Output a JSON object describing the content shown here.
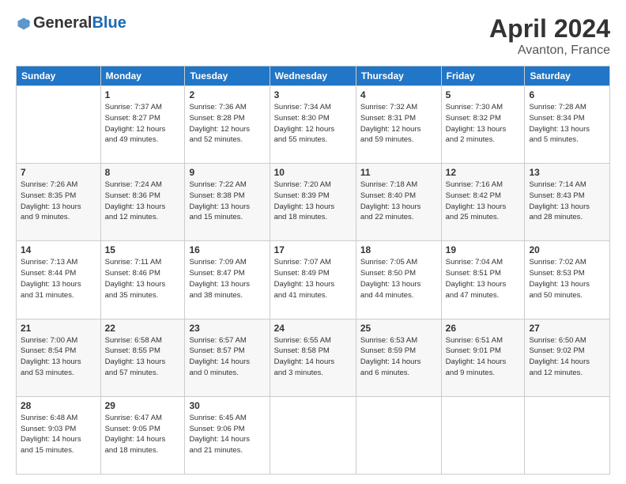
{
  "header": {
    "logo_general": "General",
    "logo_blue": "Blue",
    "month_title": "April 2024",
    "location": "Avanton, France"
  },
  "weekdays": [
    "Sunday",
    "Monday",
    "Tuesday",
    "Wednesday",
    "Thursday",
    "Friday",
    "Saturday"
  ],
  "weeks": [
    [
      {
        "day": "",
        "info": ""
      },
      {
        "day": "1",
        "info": "Sunrise: 7:37 AM\nSunset: 8:27 PM\nDaylight: 12 hours\nand 49 minutes."
      },
      {
        "day": "2",
        "info": "Sunrise: 7:36 AM\nSunset: 8:28 PM\nDaylight: 12 hours\nand 52 minutes."
      },
      {
        "day": "3",
        "info": "Sunrise: 7:34 AM\nSunset: 8:30 PM\nDaylight: 12 hours\nand 55 minutes."
      },
      {
        "day": "4",
        "info": "Sunrise: 7:32 AM\nSunset: 8:31 PM\nDaylight: 12 hours\nand 59 minutes."
      },
      {
        "day": "5",
        "info": "Sunrise: 7:30 AM\nSunset: 8:32 PM\nDaylight: 13 hours\nand 2 minutes."
      },
      {
        "day": "6",
        "info": "Sunrise: 7:28 AM\nSunset: 8:34 PM\nDaylight: 13 hours\nand 5 minutes."
      }
    ],
    [
      {
        "day": "7",
        "info": "Sunrise: 7:26 AM\nSunset: 8:35 PM\nDaylight: 13 hours\nand 9 minutes."
      },
      {
        "day": "8",
        "info": "Sunrise: 7:24 AM\nSunset: 8:36 PM\nDaylight: 13 hours\nand 12 minutes."
      },
      {
        "day": "9",
        "info": "Sunrise: 7:22 AM\nSunset: 8:38 PM\nDaylight: 13 hours\nand 15 minutes."
      },
      {
        "day": "10",
        "info": "Sunrise: 7:20 AM\nSunset: 8:39 PM\nDaylight: 13 hours\nand 18 minutes."
      },
      {
        "day": "11",
        "info": "Sunrise: 7:18 AM\nSunset: 8:40 PM\nDaylight: 13 hours\nand 22 minutes."
      },
      {
        "day": "12",
        "info": "Sunrise: 7:16 AM\nSunset: 8:42 PM\nDaylight: 13 hours\nand 25 minutes."
      },
      {
        "day": "13",
        "info": "Sunrise: 7:14 AM\nSunset: 8:43 PM\nDaylight: 13 hours\nand 28 minutes."
      }
    ],
    [
      {
        "day": "14",
        "info": "Sunrise: 7:13 AM\nSunset: 8:44 PM\nDaylight: 13 hours\nand 31 minutes."
      },
      {
        "day": "15",
        "info": "Sunrise: 7:11 AM\nSunset: 8:46 PM\nDaylight: 13 hours\nand 35 minutes."
      },
      {
        "day": "16",
        "info": "Sunrise: 7:09 AM\nSunset: 8:47 PM\nDaylight: 13 hours\nand 38 minutes."
      },
      {
        "day": "17",
        "info": "Sunrise: 7:07 AM\nSunset: 8:49 PM\nDaylight: 13 hours\nand 41 minutes."
      },
      {
        "day": "18",
        "info": "Sunrise: 7:05 AM\nSunset: 8:50 PM\nDaylight: 13 hours\nand 44 minutes."
      },
      {
        "day": "19",
        "info": "Sunrise: 7:04 AM\nSunset: 8:51 PM\nDaylight: 13 hours\nand 47 minutes."
      },
      {
        "day": "20",
        "info": "Sunrise: 7:02 AM\nSunset: 8:53 PM\nDaylight: 13 hours\nand 50 minutes."
      }
    ],
    [
      {
        "day": "21",
        "info": "Sunrise: 7:00 AM\nSunset: 8:54 PM\nDaylight: 13 hours\nand 53 minutes."
      },
      {
        "day": "22",
        "info": "Sunrise: 6:58 AM\nSunset: 8:55 PM\nDaylight: 13 hours\nand 57 minutes."
      },
      {
        "day": "23",
        "info": "Sunrise: 6:57 AM\nSunset: 8:57 PM\nDaylight: 14 hours\nand 0 minutes."
      },
      {
        "day": "24",
        "info": "Sunrise: 6:55 AM\nSunset: 8:58 PM\nDaylight: 14 hours\nand 3 minutes."
      },
      {
        "day": "25",
        "info": "Sunrise: 6:53 AM\nSunset: 8:59 PM\nDaylight: 14 hours\nand 6 minutes."
      },
      {
        "day": "26",
        "info": "Sunrise: 6:51 AM\nSunset: 9:01 PM\nDaylight: 14 hours\nand 9 minutes."
      },
      {
        "day": "27",
        "info": "Sunrise: 6:50 AM\nSunset: 9:02 PM\nDaylight: 14 hours\nand 12 minutes."
      }
    ],
    [
      {
        "day": "28",
        "info": "Sunrise: 6:48 AM\nSunset: 9:03 PM\nDaylight: 14 hours\nand 15 minutes."
      },
      {
        "day": "29",
        "info": "Sunrise: 6:47 AM\nSunset: 9:05 PM\nDaylight: 14 hours\nand 18 minutes."
      },
      {
        "day": "30",
        "info": "Sunrise: 6:45 AM\nSunset: 9:06 PM\nDaylight: 14 hours\nand 21 minutes."
      },
      {
        "day": "",
        "info": ""
      },
      {
        "day": "",
        "info": ""
      },
      {
        "day": "",
        "info": ""
      },
      {
        "day": "",
        "info": ""
      }
    ]
  ]
}
